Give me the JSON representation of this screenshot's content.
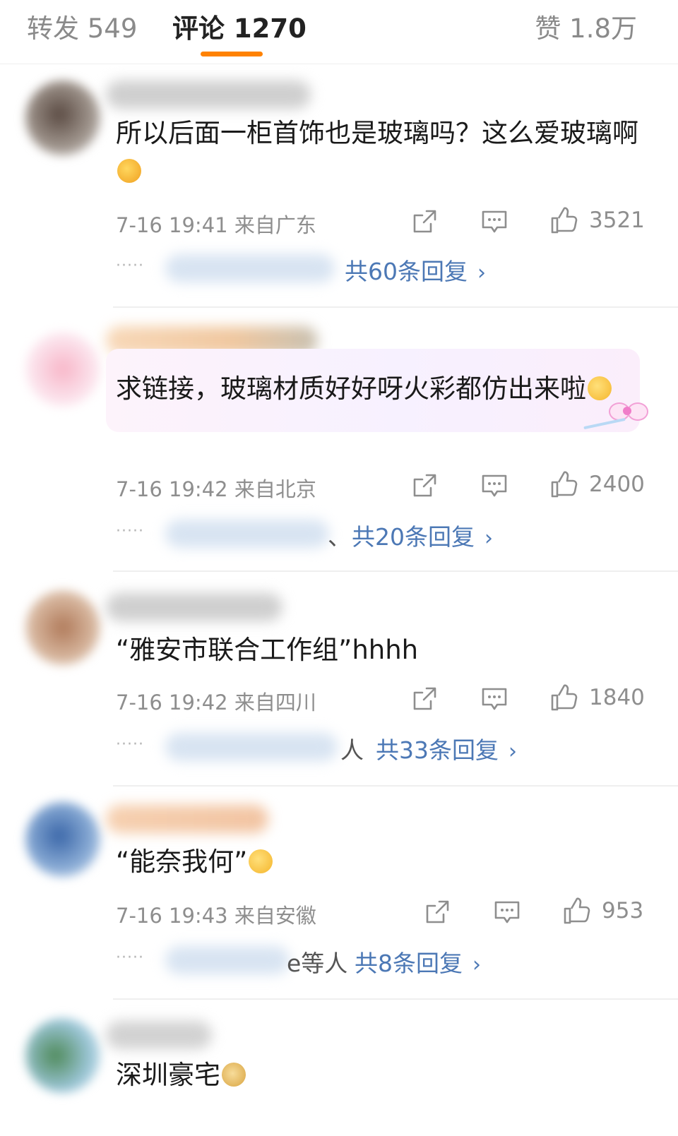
{
  "tabs": {
    "repost": "转发 549",
    "comments": "评论 1270",
    "likes": "赞 1.8万",
    "active": "comments",
    "accent_color": "#ff8200"
  },
  "icons": {
    "share": "share-icon",
    "comment": "comment-icon",
    "like": "thumbs-up-icon",
    "chevron": "chevron-right-icon"
  },
  "comments": [
    {
      "text": "所以后面一柜首饰也是玻璃吗？这么爱玻璃啊",
      "emoji": "hug-emoji",
      "time": "7-16 19:41",
      "location": "来自广东",
      "likes": "3521",
      "reply_dots": "·····",
      "reply_tail": "",
      "reply_link": "共60条回复",
      "chevron": "›"
    },
    {
      "text": "求链接，玻璃材质好好呀火彩都仿出来啦",
      "emoji": "blushing-emoji",
      "time": "7-16 19:42",
      "location": "来自北京",
      "likes": "2400",
      "reply_dots": "·····",
      "reply_tail": "、",
      "reply_link": "共20条回复",
      "chevron": "›"
    },
    {
      "text": "“雅安市联合工作组”hhhh",
      "time": "7-16 19:42",
      "location": "来自四川",
      "likes": "1840",
      "reply_dots": "·····",
      "reply_tail": "人",
      "reply_link": "共33条回复",
      "chevron": "›"
    },
    {
      "text": "“能奈我何”",
      "emoji": "shrug-emoji",
      "time": "7-16 19:43",
      "location": "来自安徽",
      "likes": "953",
      "reply_dots": "·····",
      "reply_tail": "e等人",
      "reply_link": "共8条回复",
      "chevron": "›"
    },
    {
      "text": "深圳豪宅",
      "emoji": "doge-emoji"
    }
  ]
}
